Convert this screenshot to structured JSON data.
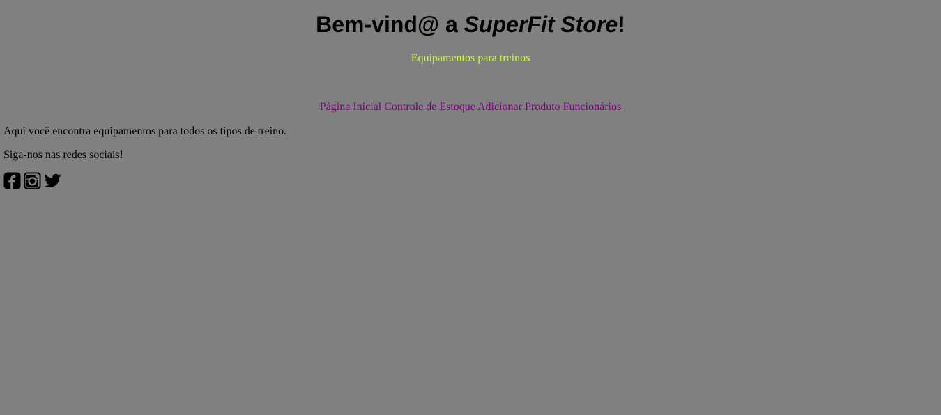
{
  "header": {
    "title_prefix": "Bem-vind@ a ",
    "title_brand": "SuperFit Store",
    "title_suffix": "!",
    "subtitle": "Equipamentos para treinos"
  },
  "nav": {
    "items": [
      {
        "label": "Página Inicial"
      },
      {
        "label": "Controle de Estoque"
      },
      {
        "label": "Adicionar Produto"
      },
      {
        "label": "Funcionários"
      }
    ]
  },
  "content": {
    "intro": "Aqui você encontra equipamentos para todos os tipos de treino.",
    "follow": "Siga-nos nas redes sociais!"
  },
  "social": {
    "icons": [
      "facebook-icon",
      "instagram-icon",
      "twitter-icon"
    ]
  },
  "colors": {
    "background": "#808080",
    "subtitle": "#ccff33",
    "link": "#800080",
    "text": "#000000"
  }
}
